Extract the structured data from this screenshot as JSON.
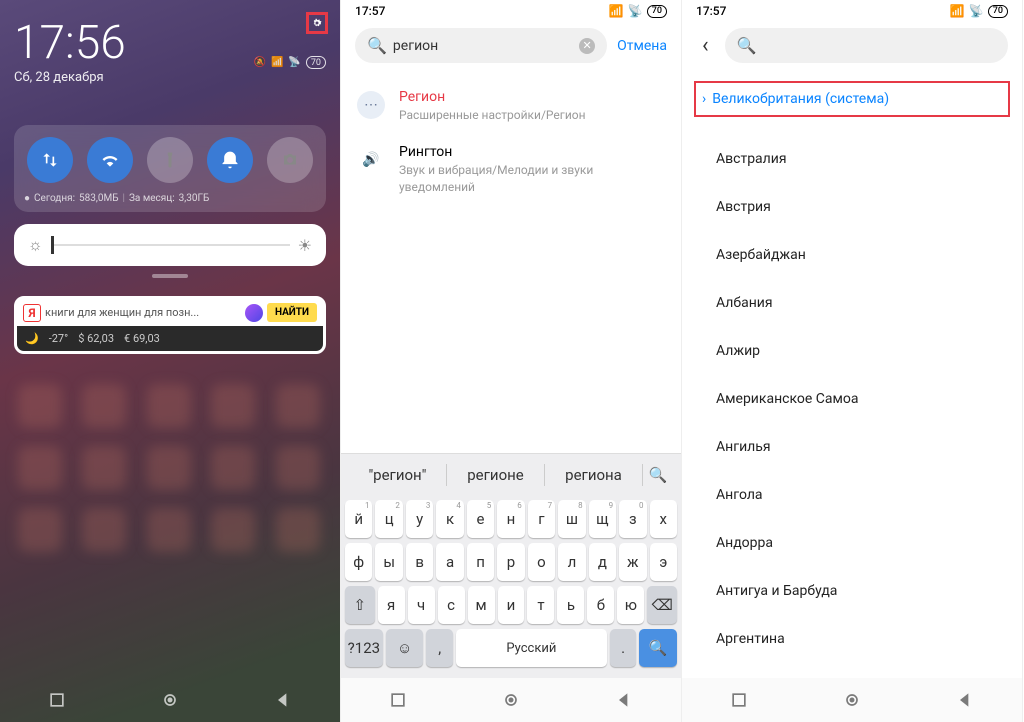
{
  "phone1": {
    "time": "17:56",
    "date": "Сб, 28 декабря",
    "battery": "70",
    "data_today_label": "Сегодня:",
    "data_today": "583,0МБ",
    "data_month_label": "За месяц:",
    "data_month": "3,30ГБ",
    "yandex_query": "книги для женщин для позн...",
    "yandex_find": "НАЙТИ",
    "weather": "-27°",
    "usd": "$ 62,03",
    "eur": "€ 69,03"
  },
  "phone2": {
    "time": "17:57",
    "battery": "70",
    "search_value": "регион",
    "cancel": "Отмена",
    "results": [
      {
        "title": "Регион",
        "sub": "Расширенные настройки/Регион",
        "highlight": true
      },
      {
        "title": "Рингтон",
        "sub": "Звук и вибрация/Мелодии и звуки уведомлений",
        "highlight": false
      }
    ],
    "suggestions": [
      "\"регион\"",
      "регионе",
      "региона"
    ],
    "kb_row1": [
      "й",
      "ц",
      "у",
      "к",
      "е",
      "н",
      "г",
      "ш",
      "щ",
      "з",
      "х"
    ],
    "kb_nums1": [
      "1",
      "2",
      "3",
      "4",
      "5",
      "6",
      "7",
      "8",
      "9",
      "0",
      ""
    ],
    "kb_row2": [
      "ф",
      "ы",
      "в",
      "а",
      "п",
      "р",
      "о",
      "л",
      "д",
      "ж",
      "э"
    ],
    "kb_row3": [
      "я",
      "ч",
      "с",
      "м",
      "и",
      "т",
      "ь",
      "б",
      "ю"
    ],
    "kb_symbols": "?123",
    "kb_space": "Русский"
  },
  "phone3": {
    "time": "17:57",
    "battery": "70",
    "selected": "Великобритания (система)",
    "countries": [
      "Австралия",
      "Австрия",
      "Азербайджан",
      "Албания",
      "Алжир",
      "Американское Самоа",
      "Ангилья",
      "Ангола",
      "Андорра",
      "Антигуа и Барбуда",
      "Аргентина"
    ]
  }
}
